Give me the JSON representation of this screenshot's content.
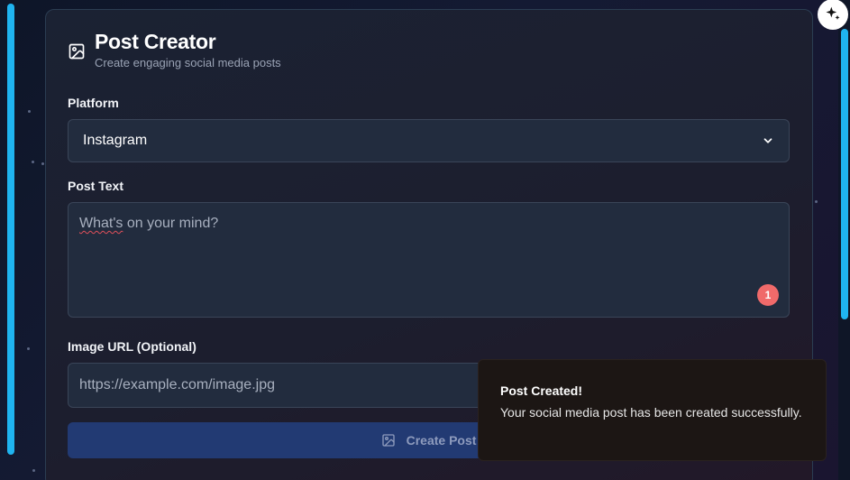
{
  "header": {
    "title": "Post Creator",
    "subtitle": "Create engaging social media posts",
    "icon": "image-icon"
  },
  "platform": {
    "label": "Platform",
    "selected": "Instagram"
  },
  "post_text": {
    "label": "Post Text",
    "placeholder": "What's on your mind?",
    "badge_count": "1"
  },
  "image_url": {
    "label": "Image URL (Optional)",
    "placeholder": "https://example.com/image.jpg"
  },
  "create_button": {
    "label": "Create Post"
  },
  "toast": {
    "title": "Post Created!",
    "body": "Your social media post has been created successfully."
  },
  "colors": {
    "accent": "#1fb4f0",
    "button_bg": "#223a73",
    "badge": "#f06a6a"
  }
}
